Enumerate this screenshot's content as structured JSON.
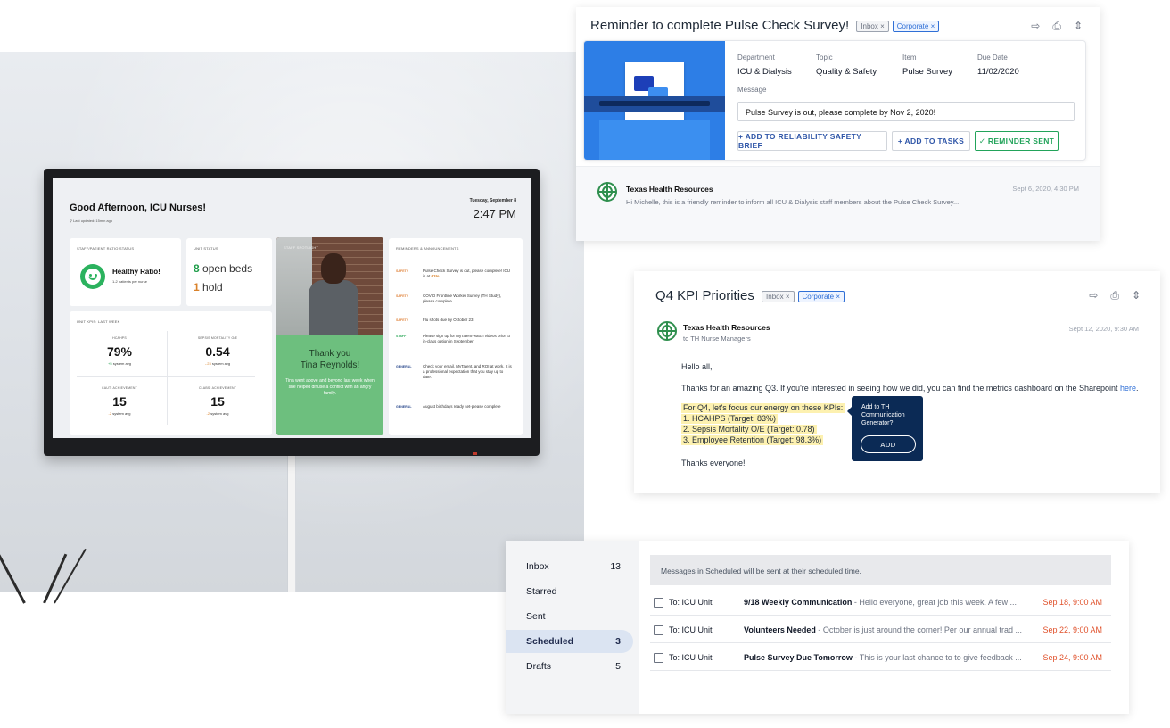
{
  "tv": {
    "greeting": "Good Afternoon, ICU Nurses!",
    "last_updated": "Last updated: 15min ago",
    "date": "Tuesday, September 8",
    "time": "2:47 PM",
    "ratio_card": {
      "heading": "STAFF/PATIENT RATIO STATUS",
      "status": "Healthy Ratio!",
      "detail": "1-2 patients per nurse"
    },
    "unit_card": {
      "heading": "UNIT STATUS",
      "beds_count": "8",
      "beds_label": "open beds",
      "hold_count": "1",
      "hold_label": "hold"
    },
    "kpi_card": {
      "heading": "UNIT KPIS: LAST WEEK",
      "items": [
        {
          "label": "HCAHPS",
          "value": "79%",
          "delta": "+5",
          "delta_suffix": "system avg",
          "trend": "positive"
        },
        {
          "label": "SEPSIS MORTALITY O/E",
          "value": "0.54",
          "delta": "-.23",
          "delta_suffix": "system avg",
          "trend": "negative"
        },
        {
          "label": "CAUTI ACHIEVEMENT",
          "value": "15",
          "delta": "-2",
          "delta_suffix": "system avg",
          "trend": "negative"
        },
        {
          "label": "CLABSI ACHIEVEMENT",
          "value": "15",
          "delta": "-2",
          "delta_suffix": "system avg",
          "trend": "negative"
        }
      ]
    },
    "spotlight": {
      "heading": "STAFF SPOTLIGHT",
      "title_line1": "Thank you",
      "title_line2": "Tina Reynolds!",
      "body": "Tina went above and beyond last week when she helped diffuse a conflict with an angry family."
    },
    "reminders": {
      "heading": "REMINDERS & ANNOUNCEMENTS",
      "items": [
        {
          "tag": "SAFETY",
          "text": "Pulse Check Survey is out, please complete! ICU is at",
          "highlight": "61%"
        },
        {
          "tag": "SAFETY",
          "text": "COVID Frontline Worker Survey (TH Study), please complete",
          "highlight": ""
        },
        {
          "tag": "SAFETY",
          "text": "Flu shots due by October 23",
          "highlight": ""
        },
        {
          "tag": "STAFF",
          "text": "Please sign up for MyTalent-watch videos prior to in-class option in September",
          "highlight": ""
        },
        {
          "tag": "GENERAL",
          "text": "Check your email. MyTalent, and RQI at work. It is a professional expectation that you stay up to date.",
          "highlight": ""
        },
        {
          "tag": "GENERAL",
          "text": "August birthdays ready set-please complete",
          "highlight": ""
        }
      ]
    },
    "colors": {
      "safety": "#e0823a",
      "staff": "#2ea85a",
      "general": "#2d4b8e",
      "healthy": "#2bb25e",
      "spotlight": "#6dbf7e"
    }
  },
  "email1": {
    "subject": "Reminder to complete Pulse Check Survey!",
    "chips": [
      "Inbox ×",
      "Corporate ×"
    ],
    "icons": [
      "forward-icon",
      "print-icon",
      "expand-icon"
    ],
    "fields": [
      {
        "label": "Department",
        "value": "ICU & Dialysis"
      },
      {
        "label": "Topic",
        "value": "Quality & Safety"
      },
      {
        "label": "Item",
        "value": "Pulse Survey"
      },
      {
        "label": "Due Date",
        "value": "11/02/2020"
      }
    ],
    "message_label": "Message",
    "message": "Pulse Survey is out, please complete by Nov 2, 2020!",
    "buttons": {
      "brief": "+ ADD TO RELIABILITY SAFETY BRIEF",
      "tasks": "+ ADD TO TASKS",
      "sent": "✓ REMINDER SENT"
    },
    "sender": "Texas Health Resources",
    "preview": "Hi Michelle, this is a friendly reminder to inform all ICU & Dialysis staff members about the Pulse Check Survey...",
    "time": "Sept 6, 2020, 4:30 PM"
  },
  "email2": {
    "subject": "Q4 KPI Priorities",
    "chips": [
      "Inbox ×",
      "Corporate ×"
    ],
    "sender": "Texas Health Resources",
    "recipient": "to TH Nurse Managers",
    "time": "Sept 12, 2020, 9:30 AM",
    "greeting": "Hello all,",
    "paragraph": "Thanks for an amazing Q3. If you're interested in seeing how we did, you can find the metrics dashboard on the Sharepoint",
    "link": "here",
    "highlights": [
      "For Q4, let's focus our energy on these KPIs:",
      "1. HCAHPS (Target: 83%)",
      "2. Sepsis Mortality O/E (Target: 0.78)",
      "3. Employee Retention (Target: 98.3%)"
    ],
    "signoff": "Thanks everyone!",
    "popup": {
      "text": "Add to TH Communication Generator?",
      "button": "ADD"
    }
  },
  "scheduled": {
    "sidebar": [
      {
        "label": "Inbox",
        "count": "13",
        "active": false
      },
      {
        "label": "Starred",
        "count": "",
        "active": false
      },
      {
        "label": "Sent",
        "count": "",
        "active": false
      },
      {
        "label": "Scheduled",
        "count": "3",
        "active": true
      },
      {
        "label": "Drafts",
        "count": "5",
        "active": false
      }
    ],
    "banner": "Messages in Scheduled will be sent at their scheduled time.",
    "rows": [
      {
        "to": "To: ICU Unit",
        "subject": "9/18 Weekly Communication",
        "snippet": " - Hello everyone, great job this week. A few ...",
        "when": "Sep 18, 9:00 AM"
      },
      {
        "to": "To: ICU Unit",
        "subject": "Volunteers Needed",
        "snippet": " - October is just around the corner! Per our annual trad ...",
        "when": "Sep 22, 9:00 AM"
      },
      {
        "to": "To: ICU Unit",
        "subject": "Pulse Survey Due Tomorrow",
        "snippet": " - This is your last chance to to give feedback ...",
        "when": "Sep 24, 9:00 AM"
      }
    ]
  }
}
